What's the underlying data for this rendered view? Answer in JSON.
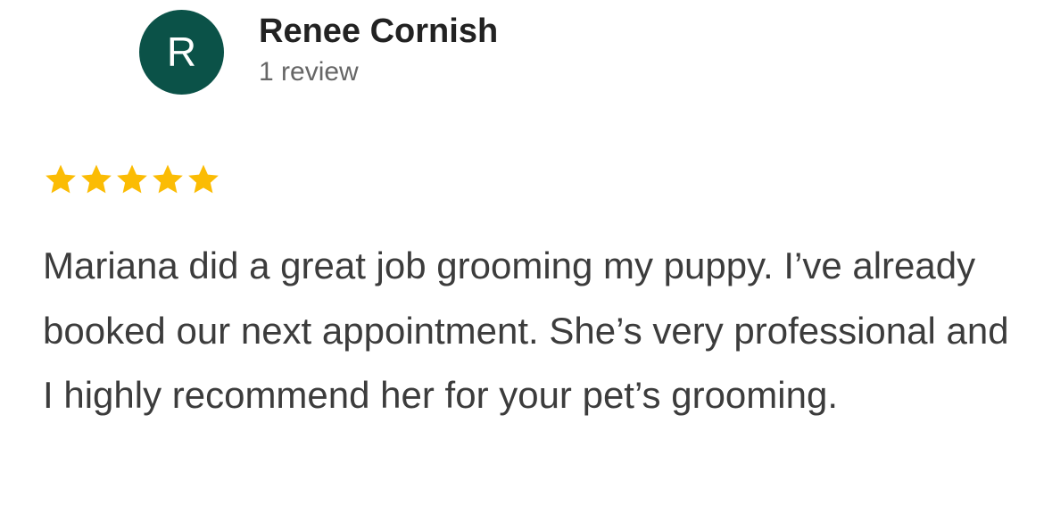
{
  "review": {
    "avatar_initial": "R",
    "reviewer_name": "Renee Cornish",
    "review_count": "1 review",
    "rating": 5,
    "rating_max": 5,
    "text": "Mariana did a great job grooming my puppy. I’ve already booked our next appointment. She’s very professional and I highly recommend her for your pet’s grooming."
  },
  "colors": {
    "avatar_bg": "#0b5248",
    "star": "#fbbc04"
  },
  "icons": {
    "star": "star-icon"
  }
}
